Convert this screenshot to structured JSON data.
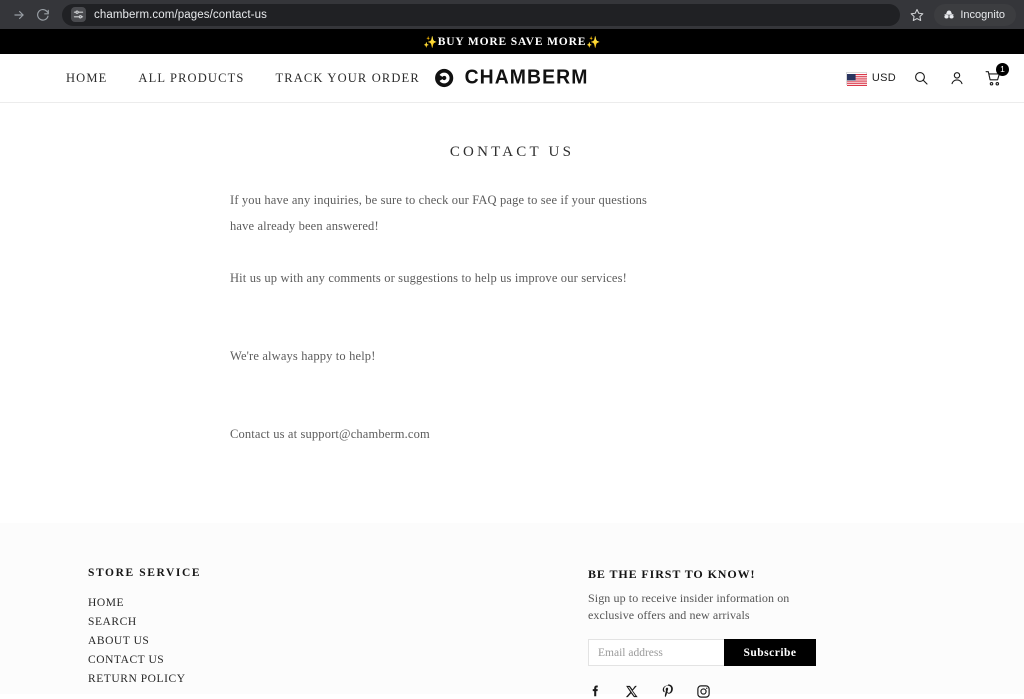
{
  "browser": {
    "url": "chamberm.com/pages/contact-us",
    "forward_icon": "forward-arrow-icon",
    "reload_icon": "reload-icon",
    "site_settings_icon": "tune-icon",
    "bookmark_icon": "star-icon",
    "incognito_label": "Incognito",
    "incognito_icon": "incognito-hat-icon",
    "chrome_bg": "#35363a",
    "omnibox_bg": "#202124"
  },
  "announcement": {
    "text": "BUY MORE SAVE MORE",
    "sparkle": "✨",
    "bg": "#000000",
    "fg": "#ffffff"
  },
  "header": {
    "nav": [
      {
        "label": "HOME"
      },
      {
        "label": "ALL PRODUCTS"
      },
      {
        "label": "TRACK YOUR ORDER"
      }
    ],
    "logo": {
      "text": "CHAMBERM",
      "mark": "circle-c-logo-icon"
    },
    "currency": {
      "code": "USD",
      "flag": "us-flag-icon"
    },
    "search_icon": "search-icon",
    "account_icon": "user-account-icon",
    "cart_icon": "shopping-cart-icon",
    "cart_count": "1"
  },
  "main": {
    "title": "CONTACT US",
    "paragraphs": [
      "If you have any inquiries, be sure to check our FAQ page to see if your questions",
      "have already been answered!",
      "Hit us up with any comments or suggestions to help us improve our services!",
      "We're always happy to help!",
      "Contact us at support@chamberm.com"
    ]
  },
  "footer": {
    "store_service": {
      "heading": "STORE SERVICE",
      "links": [
        {
          "label": "HOME"
        },
        {
          "label": "SEARCH"
        },
        {
          "label": "ABOUT US"
        },
        {
          "label": "CONTACT US"
        },
        {
          "label": "RETURN POLICY"
        }
      ]
    },
    "newsletter": {
      "heading": "BE THE FIRST TO KNOW!",
      "description": "Sign up to receive insider information on exclusive offers and new arrivals",
      "email_placeholder": "Email address",
      "email_value": "",
      "subscribe_label": "Subscribe"
    },
    "socials": [
      {
        "name": "facebook-icon"
      },
      {
        "name": "x-twitter-icon"
      },
      {
        "name": "pinterest-icon"
      },
      {
        "name": "instagram-icon"
      }
    ],
    "bg": "#fcfcfc"
  }
}
